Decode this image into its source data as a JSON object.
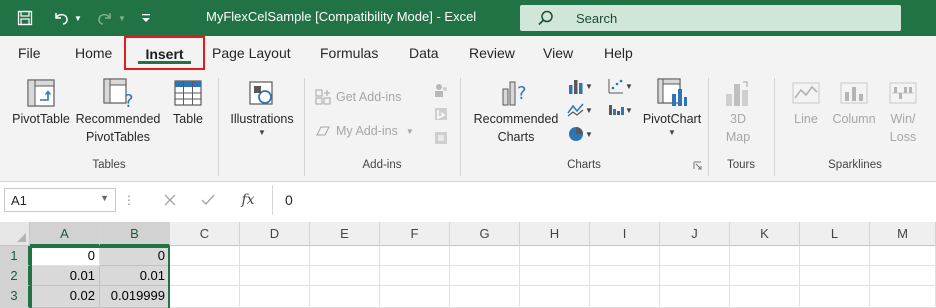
{
  "window": {
    "title": "MyFlexCelSample  [Compatibility Mode]  -  Excel",
    "search_placeholder": "Search"
  },
  "colors": {
    "accent": "#217346",
    "highlight_box": "#e21b1b",
    "ribbon_bg": "#f3f3f3"
  },
  "tabs": [
    {
      "label": "File"
    },
    {
      "label": "Home"
    },
    {
      "label": "Insert",
      "active": true
    },
    {
      "label": "Page Layout"
    },
    {
      "label": "Formulas"
    },
    {
      "label": "Data"
    },
    {
      "label": "Review"
    },
    {
      "label": "View"
    },
    {
      "label": "Help"
    }
  ],
  "ribbon": {
    "tables": {
      "pivottable": "PivotTable",
      "recommended_pivot_1": "Recommended",
      "recommended_pivot_2": "PivotTables",
      "table": "Table",
      "group_label": "Tables"
    },
    "illustrations": {
      "label": "Illustrations"
    },
    "addins": {
      "get_addins": "Get Add-ins",
      "my_addins": "My Add-ins",
      "group_label": "Add-ins"
    },
    "charts": {
      "recommended_1": "Recommended",
      "recommended_2": "Charts",
      "pivotchart": "PivotChart",
      "group_label": "Charts"
    },
    "tours": {
      "map_1": "3D",
      "map_2": "Map",
      "group_label": "Tours"
    },
    "sparklines": {
      "line": "Line",
      "column": "Column",
      "winloss_1": "Win/",
      "winloss_2": "Loss",
      "group_label": "Sparklines"
    }
  },
  "formula_bar": {
    "name_box": "A1",
    "fx": "fx",
    "content": "0"
  },
  "sheet": {
    "columns": [
      "A",
      "B",
      "C",
      "D",
      "E",
      "F",
      "G",
      "H",
      "I",
      "J",
      "K",
      "L",
      "M"
    ],
    "rows": [
      {
        "num": "1",
        "a": "0",
        "b": "0"
      },
      {
        "num": "2",
        "a": "0.01",
        "b": "0.01"
      },
      {
        "num": "3",
        "a": "0.02",
        "b": "0.019999"
      }
    ]
  }
}
